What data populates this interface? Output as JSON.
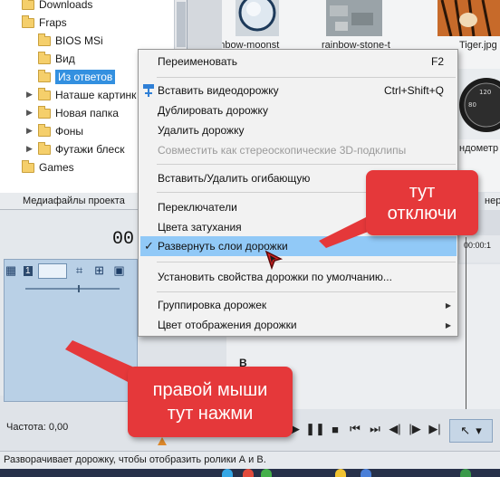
{
  "tree": {
    "items": [
      {
        "label": "Downloads"
      },
      {
        "label": "Fraps"
      },
      {
        "label": "BIOS MSi"
      },
      {
        "label": "Вид"
      },
      {
        "label": "Из ответов"
      },
      {
        "label": "Наташе картинк"
      },
      {
        "label": "Новая папка"
      },
      {
        "label": "Фоны"
      },
      {
        "label": "Футажи блеск"
      },
      {
        "label": "Games"
      }
    ],
    "tab_label": "Медиафайлы проекта"
  },
  "media": {
    "captions": [
      "rainbow-moonst",
      "rainbow-stone-t",
      "Tiger.jpg",
      "ндометр"
    ],
    "tab_fragment": "нер"
  },
  "track": {
    "time": "00",
    "track_number": "1",
    "frequency_label": "Частота: 0,00"
  },
  "timeline": {
    "ruler_time": "00:00:1",
    "b_label": "B"
  },
  "status": {
    "text": "Разворачивает дорожку, чтобы отобразить ролики А и В."
  },
  "context_menu": {
    "rename": {
      "label": "Переименовать",
      "shortcut": "F2"
    },
    "insert_video_track": {
      "label": "Вставить видеодорожку",
      "shortcut": "Ctrl+Shift+Q"
    },
    "duplicate_track": {
      "label": "Дублировать дорожку"
    },
    "delete_track": {
      "label": "Удалить дорожку"
    },
    "stereo_3d": {
      "label": "Совместить как стереоскопические 3D-подклипы"
    },
    "insert_envelope": {
      "label": "Вставить/Удалить огибающую"
    },
    "switches": {
      "label": "Переключатели"
    },
    "fade_colors": {
      "label": "Цвета затухания"
    },
    "expand_layers": {
      "label": "Развернуть слои дорожки",
      "checked": true
    },
    "set_default": {
      "label": "Установить свойства дорожки по умолчанию..."
    },
    "group_tracks": {
      "label": "Группировка дорожек"
    },
    "track_color": {
      "label": "Цвет отображения дорожки"
    }
  },
  "callouts": {
    "top_line1": "тут",
    "top_line2": "отключи",
    "bottom_line1": "правой мыши",
    "bottom_line2": "тут нажми"
  },
  "colors": {
    "callout": "#e5383a",
    "highlight": "#91c9f7",
    "selection": "#3390e0"
  }
}
